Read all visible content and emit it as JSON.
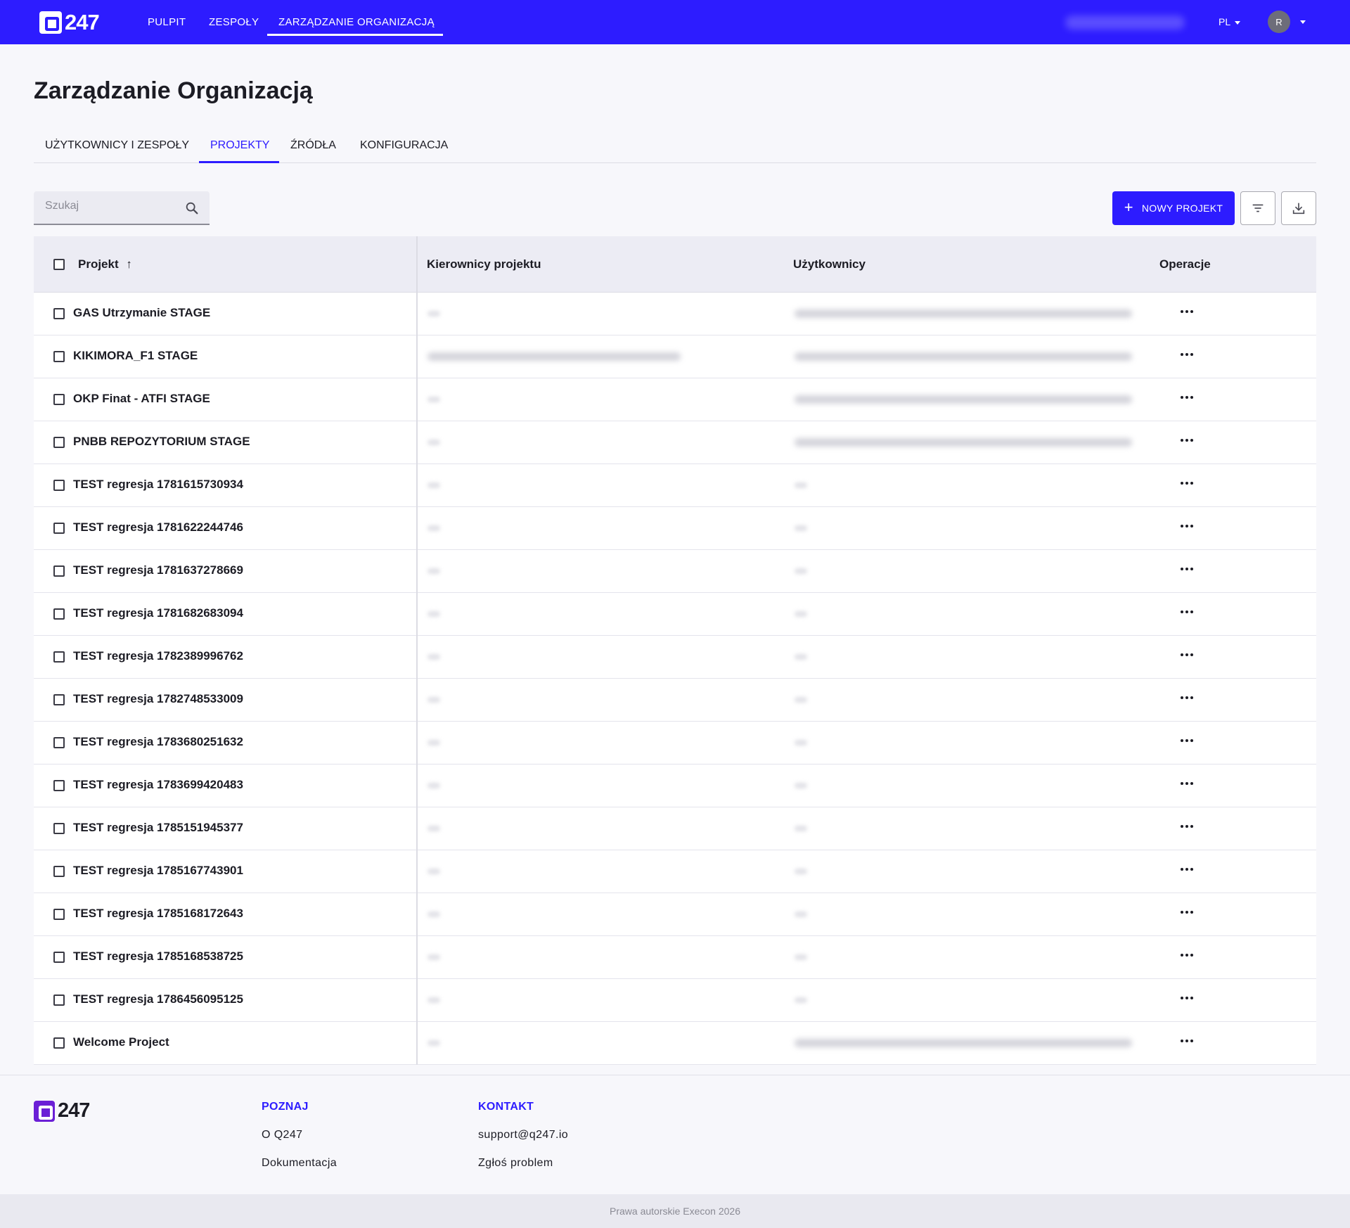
{
  "header": {
    "logo_text": "247",
    "nav": [
      "PULPIT",
      "ZESPOŁY",
      "ZARZĄDZANIE ORGANIZACJĄ"
    ],
    "active_nav": "ZARZĄDZANIE ORGANIZACJĄ",
    "language": "PL",
    "avatar_initial": "R"
  },
  "page": {
    "title": "Zarządzanie Organizacją",
    "tabs": [
      "UŻYTKOWNICY I ZESPOŁY",
      "PROJEKTY",
      "ŹRÓDŁA",
      "KONFIGURACJA"
    ],
    "active_tab": "PROJEKTY"
  },
  "toolbar": {
    "search_placeholder": "Szukaj",
    "new_project_label": "NOWY PROJEKT"
  },
  "table": {
    "columns": [
      "Projekt",
      "Kierownicy projektu",
      "Użytkownicy",
      "Operacje"
    ],
    "sort_column": "Projekt",
    "sort_direction": "ascending",
    "rows": [
      "GAS Utrzymanie STAGE",
      "KIKIMORA_F1 STAGE",
      "OKP Finat - ATFI STAGE",
      "PNBB REPOZYTORIUM STAGE",
      "TEST regresja 1781615730934",
      "TEST regresja 1781622244746",
      "TEST regresja 1781637278669",
      "TEST regresja 1781682683094",
      "TEST regresja 1782389996762",
      "TEST regresja 1782748533009",
      "TEST regresja 1783680251632",
      "TEST regresja 1783699420483",
      "TEST regresja 1785151945377",
      "TEST regresja 1785167743901",
      "TEST regresja 1785168172643",
      "TEST regresja 1785168538725",
      "TEST regresja 1786456095125",
      "Welcome Project"
    ]
  },
  "footer": {
    "logo_text": "247",
    "poznaj_heading": "POZNAJ",
    "poznaj_links": [
      "O Q247",
      "Dokumentacja"
    ],
    "kontakt_heading": "KONTAKT",
    "kontakt_links": [
      "support@q247.io",
      "Zgłoś problem"
    ],
    "copyright": "Prawa autorskie Execon 2026"
  },
  "colors": {
    "brand": "#2d1cff",
    "footer_logo": "#6b1fd6"
  }
}
